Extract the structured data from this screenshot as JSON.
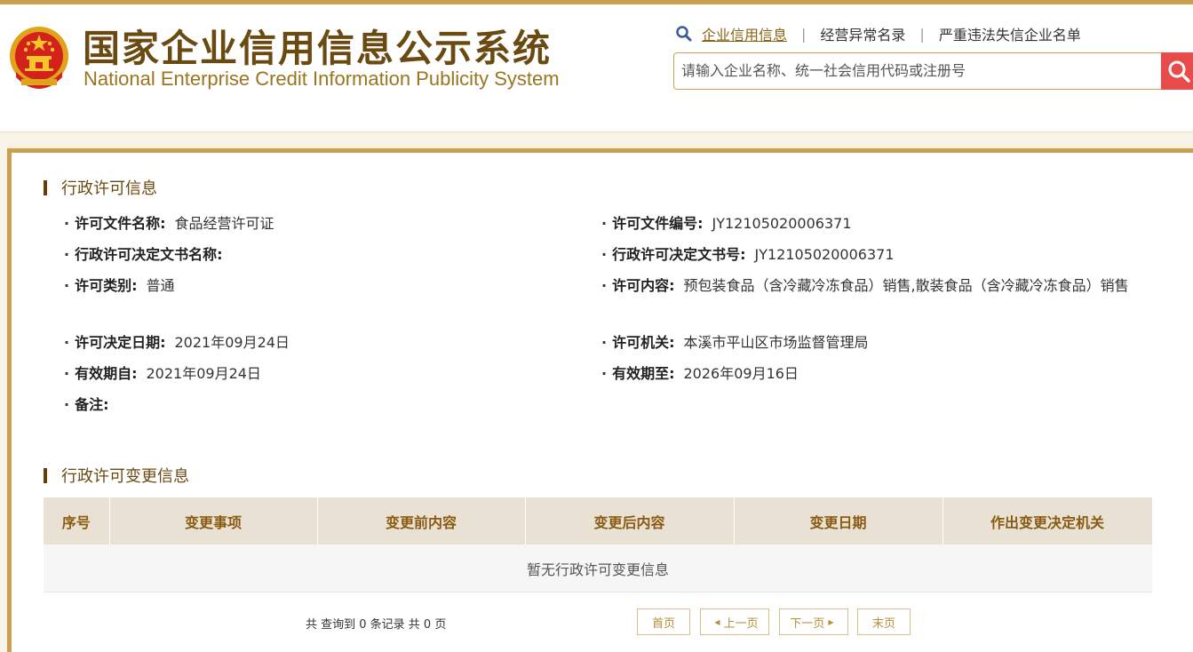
{
  "header": {
    "title_cn": "国家企业信用信息公示系统",
    "title_en": "National Enterprise Credit Information Publicity System",
    "nav": [
      "企业信用信息",
      "经营异常名录",
      "严重违法失信企业名单"
    ],
    "search_placeholder": "请输入企业名称、统一社会信用代码或注册号"
  },
  "permit": {
    "section_title": "行政许可信息",
    "doc_name_label": "许可文件名称:",
    "doc_name_value": "食品经营许可证",
    "doc_no_label": "许可文件编号:",
    "doc_no_value": "JY12105020006371",
    "decision_name_label": "行政许可决定文书名称:",
    "decision_name_value": "",
    "decision_no_label": "行政许可决定文书号:",
    "decision_no_value": "JY12105020006371",
    "type_label": "许可类别:",
    "type_value": "普通",
    "content_label": "许可内容:",
    "content_value": "预包装食品（含冷藏冷冻食品）销售,散装食品（含冷藏冷冻食品）销售",
    "date_label": "许可决定日期:",
    "date_value": "2021年09月24日",
    "authority_label": "许可机关:",
    "authority_value": "本溪市平山区市场监督管理局",
    "valid_from_label": "有效期自:",
    "valid_from_value": "2021年09月24日",
    "valid_to_label": "有效期至:",
    "valid_to_value": "2026年09月16日",
    "remark_label": "备注:",
    "remark_value": ""
  },
  "changes": {
    "section_title": "行政许可变更信息",
    "columns": [
      "序号",
      "变更事项",
      "变更前内容",
      "变更后内容",
      "变更日期",
      "作出变更决定机关"
    ],
    "empty_text": "暂无行政许可变更信息"
  },
  "pager": {
    "info": "共 查询到 0 条记录 共 0 页",
    "first": "首页",
    "prev": "上一页",
    "next": "下一页",
    "last": "末页"
  }
}
